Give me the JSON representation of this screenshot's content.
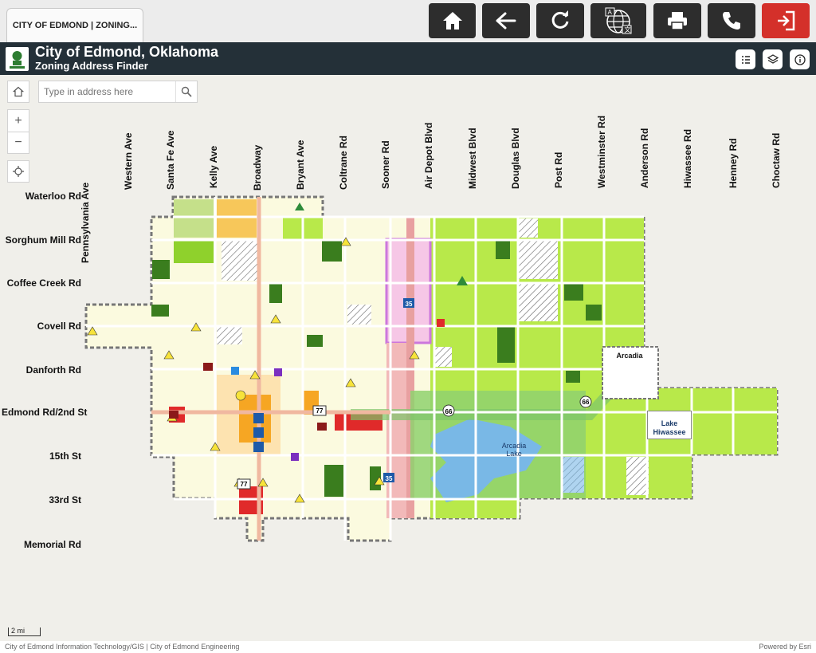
{
  "tab": {
    "label": "CITY OF EDMOND | ZONING..."
  },
  "toolbar": {
    "home": "home-icon",
    "back": "back-arrow-icon",
    "refresh": "refresh-icon",
    "translate": "translate-globe-icon",
    "print": "printer-icon",
    "phone": "phone-icon",
    "exit": "exit-icon",
    "exit_color": "#d4302a"
  },
  "header": {
    "title": "City of Edmond, Oklahoma",
    "subtitle": "Zoning Address Finder"
  },
  "header_buttons": {
    "legend": "legend-list-icon",
    "layers": "layers-icon",
    "info": "info-icon"
  },
  "search": {
    "placeholder": "Type in address here"
  },
  "map_controls": {
    "home": "home-icon",
    "zoom_in": "+",
    "zoom_out": "−",
    "locate": "locate-icon"
  },
  "streets_ns": [
    "Pennsylvania Ave",
    "Western Ave",
    "Santa Fe Ave",
    "Kelly Ave",
    "Broadway",
    "Bryant Ave",
    "Coltrane Rd",
    "Sooner Rd",
    "Air Depot Blvd",
    "Midwest Blvd",
    "Douglas Blvd",
    "Post Rd",
    "Westminster Rd",
    "Anderson Rd",
    "Hiwassee Rd",
    "Henney Rd",
    "Choctaw Rd"
  ],
  "streets_ew": [
    "Waterloo Rd",
    "Sorghum Mill Rd",
    "Coffee Creek Rd",
    "Covell Rd",
    "Danforth Rd",
    "Edmond Rd/2nd St",
    "15th St",
    "33rd St",
    "Memorial Rd"
  ],
  "places": {
    "arcadia": "Arcadia",
    "lake_hiwassee": "Lake Hiwassee",
    "arcadia_lake": "Arcadia Lake"
  },
  "highway_shields": [
    "77",
    "66",
    "66",
    "35",
    "35",
    "77"
  ],
  "scale": "2 mi",
  "attribution": "City of Edmond Information Technology/GIS | City of Edmond Engineering",
  "powered_by": "Powered by Esri",
  "colors": {
    "agricultural": "#b8e94a",
    "residential": "#fcfbe0",
    "commercial": "#e02a2a",
    "lake": "#79b8e6",
    "header": "#243038"
  }
}
